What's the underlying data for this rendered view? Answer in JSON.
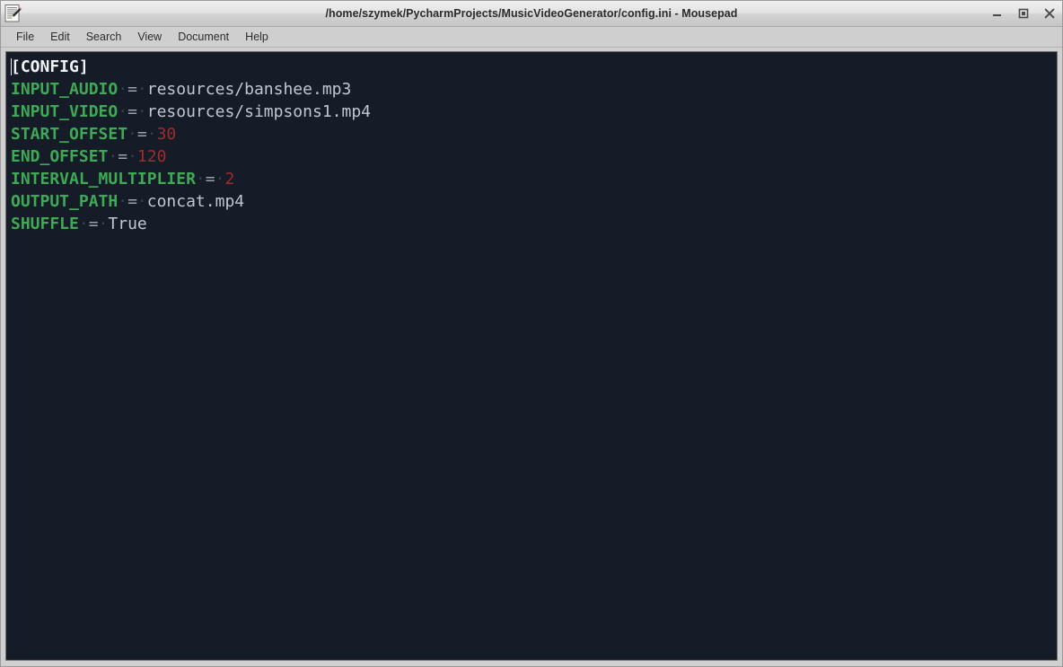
{
  "window": {
    "title": "/home/szymek/PycharmProjects/MusicVideoGenerator/config.ini - Mousepad",
    "app_icon": "mousepad-document-pencil-icon",
    "controls": {
      "minimize": "–",
      "maximize": "□",
      "close": "✕"
    }
  },
  "menubar": {
    "items": [
      {
        "label": "File"
      },
      {
        "label": "Edit"
      },
      {
        "label": "Search"
      },
      {
        "label": "View"
      },
      {
        "label": "Document"
      },
      {
        "label": "Help"
      }
    ]
  },
  "colors": {
    "editor_background": "#151b27",
    "section_header": "#f2f3f7",
    "key": "#3faa55",
    "operator": "#9aa2ae",
    "string_value": "#c0c6d2",
    "number_value": "#9e2c2c",
    "whitespace_marker": "#39404e",
    "window_chrome": "#cfcfcf",
    "titlebar": "#e4e4e4"
  },
  "editor": {
    "filename": "config.ini",
    "caret_line": 1,
    "caret_column": 0,
    "space_marker": "·",
    "lines": [
      {
        "type": "section",
        "text": "[CONFIG]"
      },
      {
        "type": "pair",
        "key": "INPUT_AUDIO",
        "operator": "=",
        "value": "resources/banshee.mp3",
        "value_type": "string"
      },
      {
        "type": "pair",
        "key": "INPUT_VIDEO",
        "operator": "=",
        "value": "resources/simpsons1.mp4",
        "value_type": "string"
      },
      {
        "type": "pair",
        "key": "START_OFFSET",
        "operator": "=",
        "value": "30",
        "value_type": "number"
      },
      {
        "type": "pair",
        "key": "END_OFFSET",
        "operator": "=",
        "value": "120",
        "value_type": "number"
      },
      {
        "type": "pair",
        "key": "INTERVAL_MULTIPLIER",
        "operator": "=",
        "value": "2",
        "value_type": "number"
      },
      {
        "type": "pair",
        "key": "OUTPUT_PATH",
        "operator": "=",
        "value": "concat.mp4",
        "value_type": "string"
      },
      {
        "type": "pair",
        "key": "SHUFFLE",
        "operator": "=",
        "value": "True",
        "value_type": "string"
      }
    ]
  }
}
